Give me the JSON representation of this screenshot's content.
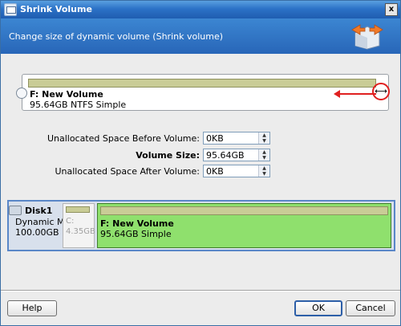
{
  "window": {
    "title": "Shrink Volume",
    "close_label": "x",
    "subtitle": "Change size of dynamic volume (Shrink volume)"
  },
  "volume": {
    "name": "F: New Volume",
    "info": "95.64GB NTFS Simple"
  },
  "fields": {
    "before_label": "Unallocated Space Before Volume:",
    "before_value": "0KB",
    "size_label": "Volume Size:",
    "size_value": "95.64GB",
    "after_label": "Unallocated Space After Volume:",
    "after_value": "0KB"
  },
  "disk": {
    "name": "Disk1",
    "type": "Dynamic MBR",
    "size": "100.00GB",
    "partitions": [
      {
        "name": "C:",
        "size": "4.35GB"
      },
      {
        "name": "F: New Volume",
        "info": "95.64GB Simple"
      }
    ]
  },
  "buttons": {
    "help": "Help",
    "ok": "OK",
    "cancel": "Cancel"
  },
  "colors": {
    "title_bar": "#2c72c7",
    "header_band": "#3c86d2",
    "volume_green": "#8fe06d",
    "arrow_red": "#e02020"
  }
}
